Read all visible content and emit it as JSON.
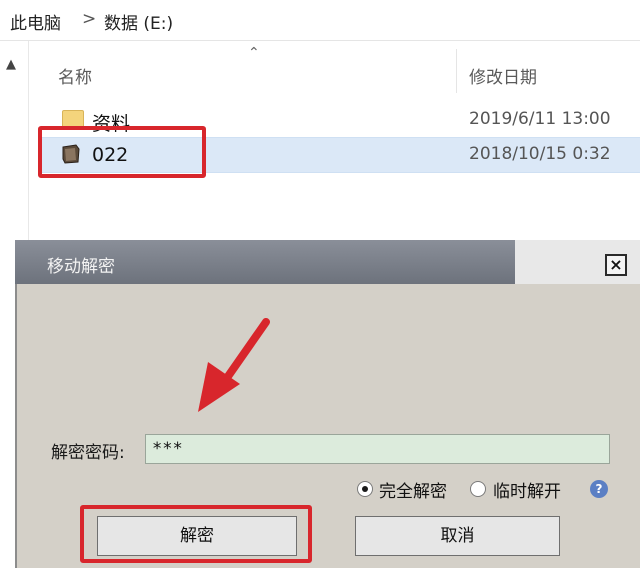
{
  "breadcrumb": {
    "root": "此电脑",
    "separator": ">",
    "drive": "数据 (E:)"
  },
  "columns": {
    "name": "名称",
    "date": "修改日期"
  },
  "files": [
    {
      "name": "资料",
      "date": "2019/6/11 13:00",
      "type": "folder"
    },
    {
      "name": "022",
      "date": "2018/10/15 0:32",
      "type": "encrypted-file"
    }
  ],
  "dialog": {
    "title": "移动解密",
    "close": "×",
    "password_label": "解密密码:",
    "password_value": "***",
    "options": [
      {
        "label": "完全解密",
        "selected": true
      },
      {
        "label": "临时解开",
        "selected": false
      }
    ],
    "help": "?",
    "decrypt_button": "解密",
    "cancel_button": "取消"
  },
  "colors": {
    "highlight": "#d8262c",
    "selected_row": "#dbe8f7",
    "dialog_bg": "#d4d0c8",
    "input_bg": "#dcebdc"
  }
}
